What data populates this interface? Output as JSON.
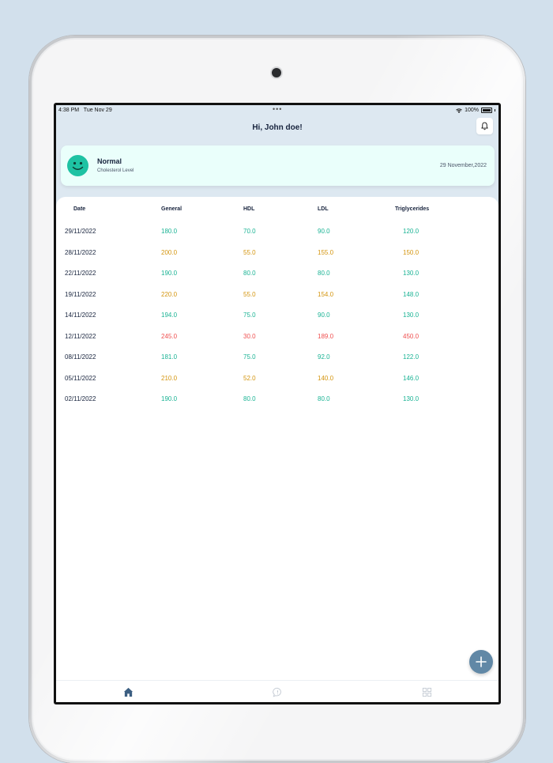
{
  "status_bar": {
    "time": "4:38 PM",
    "date": "Tue Nov 29",
    "dots": "•••",
    "battery": "100%"
  },
  "header": {
    "greeting": "Hi, John doe!",
    "bell_icon": "bell-icon"
  },
  "status_card": {
    "title": "Normal",
    "subtitle": "Cholesterol Level",
    "date": "29 November,2022",
    "icon": "smiley-icon",
    "color": "#1ec2a3"
  },
  "table": {
    "headers": [
      "Date",
      "General",
      "HDL",
      "LDL",
      "Triglycerides"
    ],
    "rows": [
      [
        "29/11/2022",
        "180.0",
        "70.0",
        "90.0",
        "120.0"
      ],
      [
        "28/11/2022",
        "200.0",
        "55.0",
        "155.0",
        "150.0"
      ],
      [
        "22/11/2022",
        "190.0",
        "80.0",
        "80.0",
        "130.0"
      ],
      [
        "19/11/2022",
        "220.0",
        "55.0",
        "154.0",
        "148.0"
      ],
      [
        "14/11/2022",
        "194.0",
        "75.0",
        "90.0",
        "130.0"
      ],
      [
        "12/11/2022",
        "245.0",
        "30.0",
        "189.0",
        "450.0"
      ],
      [
        "08/11/2022",
        "181.0",
        "75.0",
        "92.0",
        "122.0"
      ],
      [
        "05/11/2022",
        "210.0",
        "52.0",
        "140.0",
        "146.0"
      ],
      [
        "02/11/2022",
        "190.0",
        "80.0",
        "80.0",
        "130.0"
      ]
    ],
    "status_colors": [
      [
        "green",
        "green",
        "green",
        "green"
      ],
      [
        "orange",
        "orange",
        "orange",
        "orange"
      ],
      [
        "green",
        "green",
        "green",
        "green"
      ],
      [
        "orange",
        "orange",
        "orange",
        "green"
      ],
      [
        "green",
        "green",
        "green",
        "green"
      ],
      [
        "red",
        "red",
        "red",
        "red"
      ],
      [
        "green",
        "green",
        "green",
        "green"
      ],
      [
        "orange",
        "orange",
        "orange",
        "green"
      ],
      [
        "green",
        "green",
        "green",
        "green"
      ]
    ],
    "palette": {
      "green": "#1ab394",
      "orange": "#d4950f",
      "red": "#ef4f4f"
    }
  },
  "fab": {
    "icon": "plus-icon",
    "color": "#6188a6"
  },
  "tabbar": {
    "tabs": [
      {
        "icon": "home-icon",
        "active": true
      },
      {
        "icon": "chat-icon",
        "active": false
      },
      {
        "icon": "grid-icon",
        "active": false
      }
    ],
    "active_color": "#3c5f82",
    "inactive_color": "#c3cad3"
  }
}
